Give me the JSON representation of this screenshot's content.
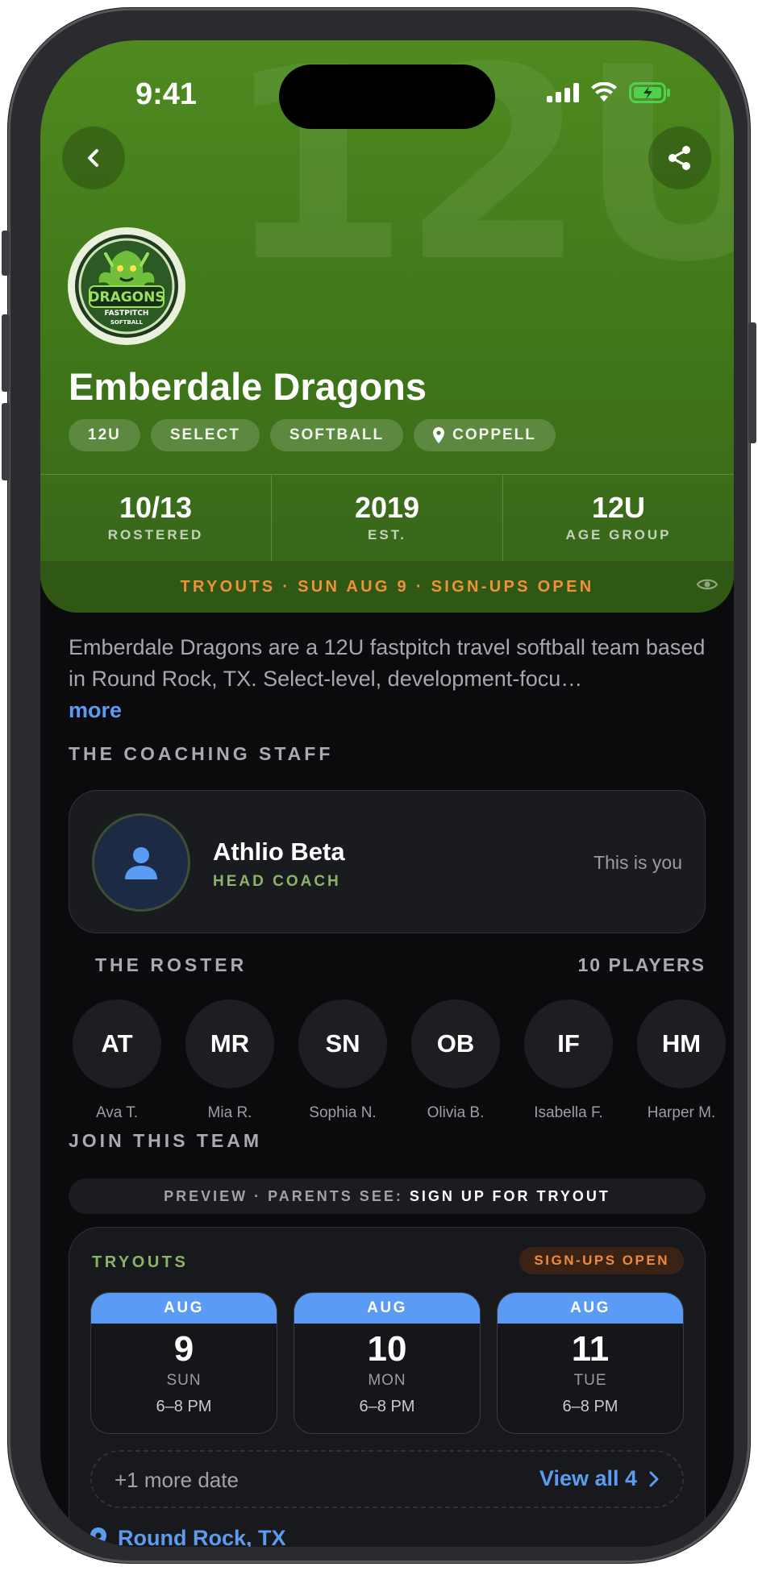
{
  "status_bar": {
    "time": "9:41"
  },
  "header": {
    "watermark": "12U",
    "team_name": "Emberdale Dragons",
    "logo_text": {
      "line1": "DRAGONS",
      "line2": "FASTPITCH",
      "line3": "SOFTBALL"
    },
    "chips": [
      "12U",
      "SELECT",
      "SOFTBALL",
      "COPPELL"
    ],
    "stats": [
      {
        "value": "10/13",
        "label": "ROSTERED"
      },
      {
        "value": "2019",
        "label": "EST."
      },
      {
        "value": "12U",
        "label": "AGE GROUP"
      }
    ],
    "tryout_banner": "TRYOUTS · SUN AUG 9 · SIGN-UPS OPEN"
  },
  "description": {
    "text": "Emberdale Dragons are a 12U fastpitch travel softball team based in Round Rock, TX. Select-level, development-focu…",
    "more_label": "more"
  },
  "coaching_staff": {
    "title": "THE COACHING STAFF",
    "coach": {
      "name": "Athlio Beta",
      "role": "HEAD COACH",
      "note": "This is you"
    }
  },
  "roster": {
    "title": "THE ROSTER",
    "count_label": "10 PLAYERS",
    "players": [
      {
        "initials": "AT",
        "name": "Ava T."
      },
      {
        "initials": "MR",
        "name": "Mia R."
      },
      {
        "initials": "SN",
        "name": "Sophia N."
      },
      {
        "initials": "OB",
        "name": "Olivia B."
      },
      {
        "initials": "IF",
        "name": "Isabella F."
      },
      {
        "initials": "HM",
        "name": "Harper M."
      }
    ]
  },
  "join": {
    "title": "JOIN THIS TEAM",
    "preview_prefix": "PREVIEW · PARENTS SEE:",
    "preview_action": "SIGN UP FOR TRYOUT",
    "tryouts_label": "TRYOUTS",
    "status_badge": "SIGN-UPS OPEN",
    "dates": [
      {
        "month": "AUG",
        "day": "9",
        "dow": "SUN",
        "time": "6–8 PM"
      },
      {
        "month": "AUG",
        "day": "10",
        "dow": "MON",
        "time": "6–8 PM"
      },
      {
        "month": "AUG",
        "day": "11",
        "dow": "TUE",
        "time": "6–8 PM"
      }
    ],
    "more_dates": "+1 more date",
    "view_all": "View all 4",
    "location": "Round Rock, TX"
  },
  "colors": {
    "header_green": "#3f7619",
    "accent_blue": "#5a9cf5",
    "accent_orange": "#f0913a",
    "coach_green": "#8cb36a",
    "background": "#0b0b0d"
  }
}
